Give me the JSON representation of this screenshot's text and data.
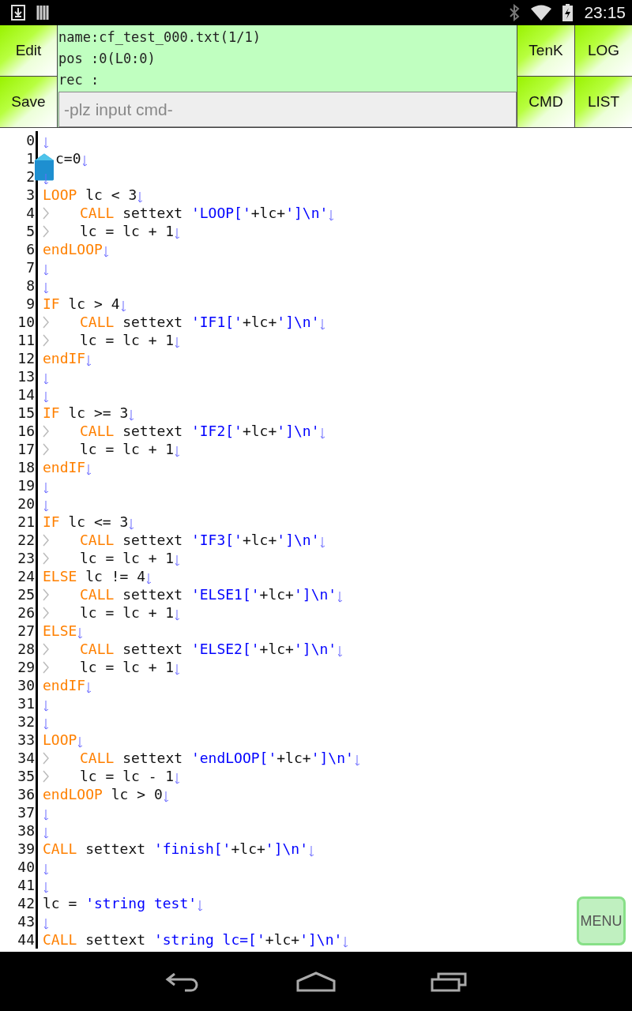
{
  "status_bar": {
    "time": "23:15"
  },
  "left_buttons": [
    "Edit",
    "Save"
  ],
  "info": {
    "lines": [
      "name:cf_test_000.txt(1/1)",
      "pos :0(L0:0)",
      "rec :"
    ]
  },
  "command": {
    "placeholder": "-plz input cmd-"
  },
  "right_buttons": [
    "TenK",
    "LOG",
    "CMD",
    "LIST"
  ],
  "editor": {
    "lines": [
      {
        "number": "0",
        "indent": false,
        "cursor": false
      },
      {
        "number": "1",
        "indent": false,
        "cursor": true,
        "tokens": [
          {
            "kind": "plain",
            "text": "c=0"
          }
        ]
      },
      {
        "number": "2",
        "indent": false,
        "cursor": false
      },
      {
        "number": "3",
        "indent": false,
        "cursor": false,
        "tokens": [
          {
            "kind": "keyword",
            "text": "LOOP"
          },
          {
            "kind": "plain",
            "text": " lc < 3"
          }
        ]
      },
      {
        "number": "4",
        "indent": true,
        "cursor": false,
        "tokens": [
          {
            "kind": "keyword",
            "text": "CALL"
          },
          {
            "kind": "plain",
            "text": " settext "
          },
          {
            "kind": "string",
            "text": "'LOOP['"
          },
          {
            "kind": "plain",
            "text": "+lc+"
          },
          {
            "kind": "string",
            "text": "']\\n'"
          }
        ]
      },
      {
        "number": "5",
        "indent": true,
        "cursor": false,
        "tokens": [
          {
            "kind": "plain",
            "text": "lc = lc + 1"
          }
        ]
      },
      {
        "number": "6",
        "indent": false,
        "cursor": false,
        "tokens": [
          {
            "kind": "keyword",
            "text": "endLOOP"
          }
        ]
      },
      {
        "number": "7",
        "indent": false,
        "cursor": false
      },
      {
        "number": "8",
        "indent": false,
        "cursor": false
      },
      {
        "number": "9",
        "indent": false,
        "cursor": false,
        "tokens": [
          {
            "kind": "keyword",
            "text": "IF"
          },
          {
            "kind": "plain",
            "text": " lc > 4"
          }
        ]
      },
      {
        "number": "10",
        "indent": true,
        "cursor": false,
        "tokens": [
          {
            "kind": "keyword",
            "text": "CALL"
          },
          {
            "kind": "plain",
            "text": " settext "
          },
          {
            "kind": "string",
            "text": "'IF1['"
          },
          {
            "kind": "plain",
            "text": "+lc+"
          },
          {
            "kind": "string",
            "text": "']\\n'"
          }
        ]
      },
      {
        "number": "11",
        "indent": true,
        "cursor": false,
        "tokens": [
          {
            "kind": "plain",
            "text": "lc = lc + 1"
          }
        ]
      },
      {
        "number": "12",
        "indent": false,
        "cursor": false,
        "tokens": [
          {
            "kind": "keyword",
            "text": "endIF"
          }
        ]
      },
      {
        "number": "13",
        "indent": false,
        "cursor": false
      },
      {
        "number": "14",
        "indent": false,
        "cursor": false
      },
      {
        "number": "15",
        "indent": false,
        "cursor": false,
        "tokens": [
          {
            "kind": "keyword",
            "text": "IF"
          },
          {
            "kind": "plain",
            "text": " lc >= 3"
          }
        ]
      },
      {
        "number": "16",
        "indent": true,
        "cursor": false,
        "tokens": [
          {
            "kind": "keyword",
            "text": "CALL"
          },
          {
            "kind": "plain",
            "text": " settext "
          },
          {
            "kind": "string",
            "text": "'IF2['"
          },
          {
            "kind": "plain",
            "text": "+lc+"
          },
          {
            "kind": "string",
            "text": "']\\n'"
          }
        ]
      },
      {
        "number": "17",
        "indent": true,
        "cursor": false,
        "tokens": [
          {
            "kind": "plain",
            "text": "lc = lc + 1"
          }
        ]
      },
      {
        "number": "18",
        "indent": false,
        "cursor": false,
        "tokens": [
          {
            "kind": "keyword",
            "text": "endIF"
          }
        ]
      },
      {
        "number": "19",
        "indent": false,
        "cursor": false
      },
      {
        "number": "20",
        "indent": false,
        "cursor": false
      },
      {
        "number": "21",
        "indent": false,
        "cursor": false,
        "tokens": [
          {
            "kind": "keyword",
            "text": "IF"
          },
          {
            "kind": "plain",
            "text": " lc <= 3"
          }
        ]
      },
      {
        "number": "22",
        "indent": true,
        "cursor": false,
        "tokens": [
          {
            "kind": "keyword",
            "text": "CALL"
          },
          {
            "kind": "plain",
            "text": " settext "
          },
          {
            "kind": "string",
            "text": "'IF3['"
          },
          {
            "kind": "plain",
            "text": "+lc+"
          },
          {
            "kind": "string",
            "text": "']\\n'"
          }
        ]
      },
      {
        "number": "23",
        "indent": true,
        "cursor": false,
        "tokens": [
          {
            "kind": "plain",
            "text": "lc = lc + 1"
          }
        ]
      },
      {
        "number": "24",
        "indent": false,
        "cursor": false,
        "tokens": [
          {
            "kind": "keyword",
            "text": "ELSE"
          },
          {
            "kind": "plain",
            "text": " lc != 4"
          }
        ]
      },
      {
        "number": "25",
        "indent": true,
        "cursor": false,
        "tokens": [
          {
            "kind": "keyword",
            "text": "CALL"
          },
          {
            "kind": "plain",
            "text": " settext "
          },
          {
            "kind": "string",
            "text": "'ELSE1['"
          },
          {
            "kind": "plain",
            "text": "+lc+"
          },
          {
            "kind": "string",
            "text": "']\\n'"
          }
        ]
      },
      {
        "number": "26",
        "indent": true,
        "cursor": false,
        "tokens": [
          {
            "kind": "plain",
            "text": "lc = lc + 1"
          }
        ]
      },
      {
        "number": "27",
        "indent": false,
        "cursor": false,
        "tokens": [
          {
            "kind": "keyword",
            "text": "ELSE"
          }
        ]
      },
      {
        "number": "28",
        "indent": true,
        "cursor": false,
        "tokens": [
          {
            "kind": "keyword",
            "text": "CALL"
          },
          {
            "kind": "plain",
            "text": " settext "
          },
          {
            "kind": "string",
            "text": "'ELSE2['"
          },
          {
            "kind": "plain",
            "text": "+lc+"
          },
          {
            "kind": "string",
            "text": "']\\n'"
          }
        ]
      },
      {
        "number": "29",
        "indent": true,
        "cursor": false,
        "tokens": [
          {
            "kind": "plain",
            "text": "lc = lc + 1"
          }
        ]
      },
      {
        "number": "30",
        "indent": false,
        "cursor": false,
        "tokens": [
          {
            "kind": "keyword",
            "text": "endIF"
          }
        ]
      },
      {
        "number": "31",
        "indent": false,
        "cursor": false
      },
      {
        "number": "32",
        "indent": false,
        "cursor": false
      },
      {
        "number": "33",
        "indent": false,
        "cursor": false,
        "tokens": [
          {
            "kind": "keyword",
            "text": "LOOP"
          }
        ]
      },
      {
        "number": "34",
        "indent": true,
        "cursor": false,
        "tokens": [
          {
            "kind": "keyword",
            "text": "CALL"
          },
          {
            "kind": "plain",
            "text": " settext "
          },
          {
            "kind": "string",
            "text": "'endLOOP['"
          },
          {
            "kind": "plain",
            "text": "+lc+"
          },
          {
            "kind": "string",
            "text": "']\\n'"
          }
        ]
      },
      {
        "number": "35",
        "indent": true,
        "cursor": false,
        "tokens": [
          {
            "kind": "plain",
            "text": "lc = lc - 1"
          }
        ]
      },
      {
        "number": "36",
        "indent": false,
        "cursor": false,
        "tokens": [
          {
            "kind": "keyword",
            "text": "endLOOP"
          },
          {
            "kind": "plain",
            "text": " lc > 0"
          }
        ]
      },
      {
        "number": "37",
        "indent": false,
        "cursor": false
      },
      {
        "number": "38",
        "indent": false,
        "cursor": false
      },
      {
        "number": "39",
        "indent": false,
        "cursor": false,
        "tokens": [
          {
            "kind": "keyword",
            "text": "CALL"
          },
          {
            "kind": "plain",
            "text": " settext "
          },
          {
            "kind": "string",
            "text": "'finish['"
          },
          {
            "kind": "plain",
            "text": "+lc+"
          },
          {
            "kind": "string",
            "text": "']\\n'"
          }
        ]
      },
      {
        "number": "40",
        "indent": false,
        "cursor": false
      },
      {
        "number": "41",
        "indent": false,
        "cursor": false
      },
      {
        "number": "42",
        "indent": false,
        "cursor": false,
        "tokens": [
          {
            "kind": "plain",
            "text": "lc = "
          },
          {
            "kind": "string",
            "text": "'string test'"
          }
        ]
      },
      {
        "number": "43",
        "indent": false,
        "cursor": false
      },
      {
        "number": "44",
        "indent": false,
        "cursor": false,
        "tokens": [
          {
            "kind": "keyword",
            "text": "CALL"
          },
          {
            "kind": "plain",
            "text": " settext "
          },
          {
            "kind": "string",
            "text": "'string lc=['"
          },
          {
            "kind": "plain",
            "text": "+lc+"
          },
          {
            "kind": "string",
            "text": "']\\n'"
          }
        ]
      }
    ]
  },
  "menu_button": "MENU"
}
